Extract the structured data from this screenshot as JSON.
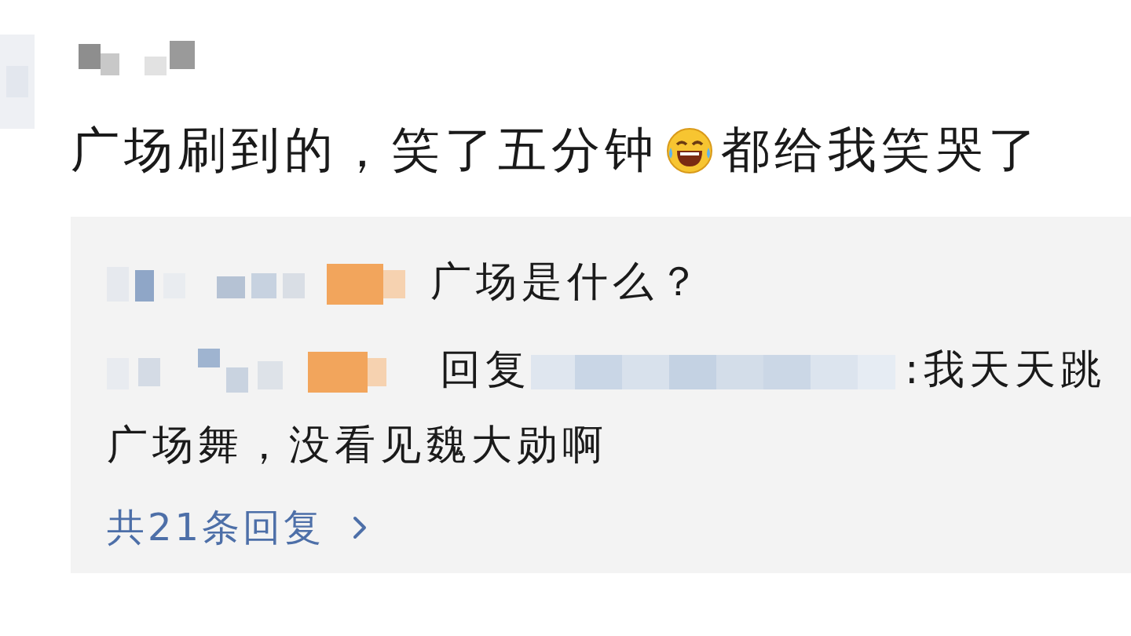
{
  "post": {
    "text_before_emoji": "广场刷到的，笑了五分钟",
    "text_after_emoji": "都给我笑哭了"
  },
  "replies": [
    {
      "kind": "comment",
      "text": "广场是什么？"
    },
    {
      "kind": "reply",
      "reply_label": "回复",
      "lines": [
        ":我天天跳",
        "广场舞，没看见魏大勋啊"
      ]
    }
  ],
  "more_replies": {
    "label": "共21条回复"
  }
}
